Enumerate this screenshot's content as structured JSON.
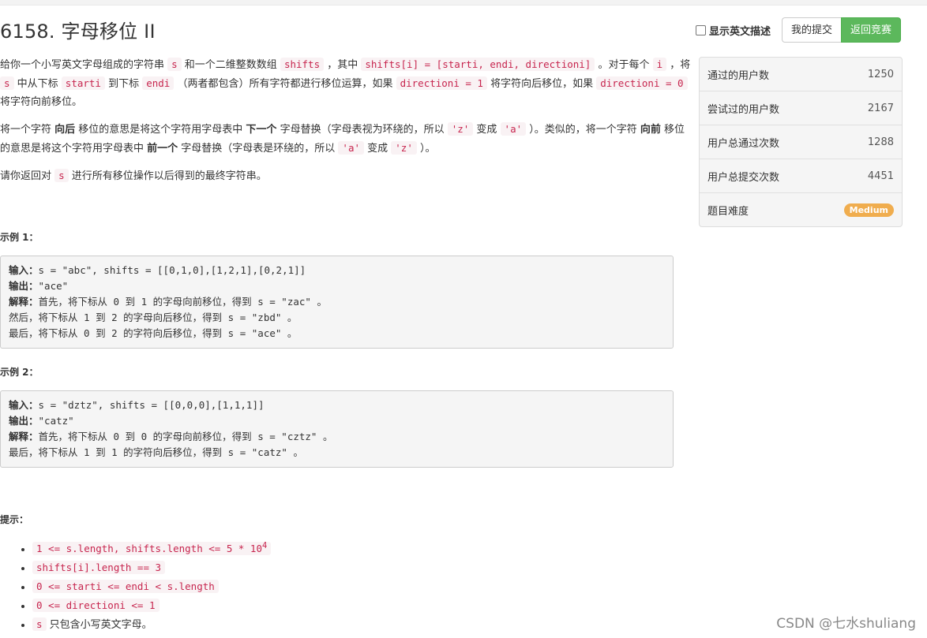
{
  "title": "6158. 字母移位 II",
  "actions": {
    "show_english_label": "显示英文描述",
    "my_submissions_label": "我的提交",
    "back_to_contest_label": "返回竞赛"
  },
  "description": {
    "p1": {
      "t1": "给你一个小写英文字母组成的字符串 ",
      "c1": "s",
      "t2": " 和一个二维整数数组 ",
      "c2": "shifts",
      "t3": " ，其中 ",
      "c3": "shifts[i] = [starti, endi, directioni]",
      "t4": " 。对于每个 ",
      "c4": "i",
      "t5": " ，将 ",
      "c5": "s",
      "t6": " 中从下标 ",
      "c6": "starti",
      "t7": " 到下标 ",
      "c7": "endi",
      "t8": " （两者都包含）所有字符都进行移位运算，如果 ",
      "c8": "directioni = 1",
      "t9": " 将字符向后移位，如果 ",
      "c9": "directioni = 0",
      "t10": " 将字符向前移位。"
    },
    "p2": {
      "t1": "将一个字符 ",
      "b1": "向后",
      "t2": " 移位的意思是将这个字符用字母表中 ",
      "b2": "下一个",
      "t3": " 字母替换（字母表视为环绕的，所以 ",
      "c1": "'z'",
      "t4": " 变成 ",
      "c2": "'a'",
      "t5": " ）。类似的，将一个字符 ",
      "b3": "向前",
      "t6": " 移位的意思是将这个字符用字母表中 ",
      "b4": "前一个",
      "t7": " 字母替换（字母表是环绕的，所以 ",
      "c3": "'a'",
      "t8": " 变成 ",
      "c4": "'z'",
      "t9": " ）。"
    },
    "p3": {
      "t1": "请你返回对 ",
      "c1": "s",
      "t2": " 进行所有移位操作以后得到的最终字符串。"
    }
  },
  "example1": {
    "label": "示例 1：",
    "input_label": "输入：",
    "input": "s = \"abc\", shifts = [[0,1,0],[1,2,1],[0,2,1]]",
    "output_label": "输出：",
    "output": "\"ace\"",
    "explain_label": "解释：",
    "lines": [
      "首先，将下标从 0 到 1 的字母向前移位，得到 s = \"zac\" 。",
      "然后，将下标从 1 到 2 的字母向后移位，得到 s = \"zbd\" 。",
      "最后，将下标从 0 到 2 的字符向后移位，得到 s = \"ace\" 。"
    ]
  },
  "example2": {
    "label": "示例 2：",
    "input_label": "输入：",
    "input": "s = \"dztz\", shifts = [[0,0,0],[1,1,1]]",
    "output_label": "输出：",
    "output": "\"catz\"",
    "explain_label": "解释：",
    "lines": [
      "首先，将下标从 0 到 0 的字母向前移位，得到 s = \"cztz\" 。",
      "最后，将下标从 1 到 1 的字符向后移位，得到 s = \"catz\" 。"
    ]
  },
  "hints": {
    "label": "提示：",
    "h1": "1 <= s.length, shifts.length <= 5 * 10",
    "h1_sup": "4",
    "h2": "shifts[i].length == 3",
    "h3": "0 <= starti <= endi < s.length",
    "h4": "0 <= directioni <= 1",
    "h5_code": "s",
    "h5_text": " 只包含小写英文字母。"
  },
  "stats": [
    {
      "label": "通过的用户数",
      "value": "1250"
    },
    {
      "label": "尝试过的用户数",
      "value": "2167"
    },
    {
      "label": "用户总通过次数",
      "value": "1288"
    },
    {
      "label": "用户总提交次数",
      "value": "4451"
    }
  ],
  "difficulty": {
    "label": "题目难度",
    "value": "Medium"
  },
  "watermark": "CSDN @七水shuliang",
  "colors": {
    "primary_button": "#5cb85c",
    "difficulty_badge": "#f0ad4e",
    "code_text": "#c7254e"
  }
}
